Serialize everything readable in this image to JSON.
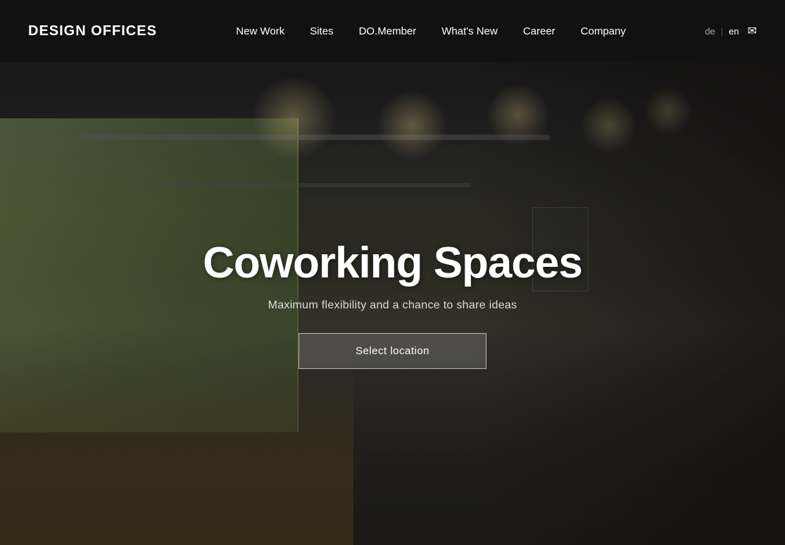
{
  "header": {
    "logo": "DESIGN OFFICES",
    "nav": [
      {
        "id": "new-work",
        "label": "New Work"
      },
      {
        "id": "sites",
        "label": "Sites"
      },
      {
        "id": "do-member",
        "label": "DO.Member"
      },
      {
        "id": "whats-new",
        "label": "What's New"
      },
      {
        "id": "career",
        "label": "Career"
      },
      {
        "id": "company",
        "label": "Company"
      }
    ],
    "lang": {
      "de": "de",
      "separator": "|",
      "en": "en"
    },
    "mail_icon": "✉"
  },
  "hero": {
    "title": "Coworking Spaces",
    "subtitle": "Maximum flexibility and a chance to share ideas",
    "cta_label": "Select location"
  }
}
